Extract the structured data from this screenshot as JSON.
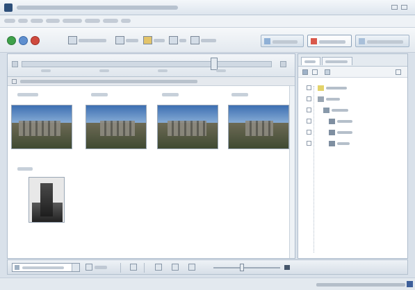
{
  "window": {
    "title": ""
  },
  "menu": {
    "items": [
      "",
      "",
      "",
      "",
      "",
      "",
      "",
      ""
    ]
  },
  "toolbar": {
    "tools": [
      "",
      "",
      "",
      "",
      ""
    ],
    "views": [
      {
        "label": "",
        "active": false
      },
      {
        "label": "",
        "active": true
      },
      {
        "label": "",
        "active": false
      }
    ]
  },
  "browser": {
    "info_text": "",
    "sections": [
      {
        "heading": "",
        "photo_count": 4
      },
      {
        "heading": "",
        "photo_count": 1
      }
    ]
  },
  "side_panel": {
    "tabs": [
      "",
      ""
    ],
    "tree": [
      "",
      "",
      "",
      "",
      "",
      ""
    ]
  },
  "bottom_bar": {
    "zoom_field": ""
  },
  "status_bar": {
    "text": ""
  },
  "colors": {
    "accent": "#3d6fb2",
    "chrome": "#d9e1ea"
  }
}
